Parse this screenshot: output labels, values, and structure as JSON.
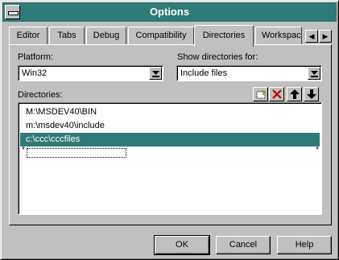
{
  "window": {
    "title": "Options"
  },
  "tabs": [
    {
      "label": "Editor"
    },
    {
      "label": "Tabs"
    },
    {
      "label": "Debug"
    },
    {
      "label": "Compatibility"
    },
    {
      "label": "Directories",
      "active": true
    },
    {
      "label": "Workspace"
    }
  ],
  "tab_scroll": {
    "left_icon": "tab-scroll-left-icon",
    "right_icon": "tab-scroll-right-icon"
  },
  "platform": {
    "label": "Platform:",
    "value": "Win32"
  },
  "show_dirs": {
    "label": "Show directories for:",
    "value": "Include files"
  },
  "directories": {
    "label": "Directories:",
    "items": [
      "M:\\MSDEV40\\BIN",
      "m:\\msdev40\\include",
      "c:\\ccc\\cccfiles"
    ],
    "selected_index": 2
  },
  "toolbar": {
    "new_icon": "new-folder-icon",
    "delete_icon": "delete-icon",
    "up_icon": "move-up-icon",
    "down_icon": "move-down-icon"
  },
  "buttons": {
    "ok": "OK",
    "cancel": "Cancel",
    "help": "Help"
  },
  "colors": {
    "title_bar": "#2f7a76",
    "selection": "#2f7a76",
    "face": "#c0c0c0"
  }
}
